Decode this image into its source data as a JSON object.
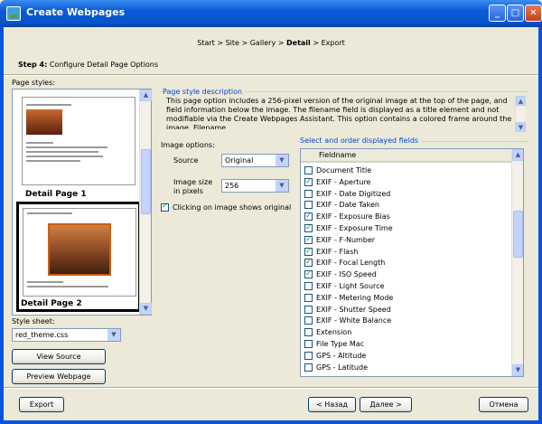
{
  "window": {
    "title": "Create Webpages"
  },
  "breadcrumb": {
    "pre": "Start > Site > Gallery > ",
    "current": "Detail",
    "post": " > Export"
  },
  "step": {
    "bold": "Step 4:",
    "text": " Configure Detail Page Options"
  },
  "page_styles": {
    "label": "Page styles:",
    "items": [
      {
        "caption": "Detail Page 1",
        "selected": false
      },
      {
        "caption": "Detail Page 2",
        "selected": true
      }
    ]
  },
  "style_sheet": {
    "label": "Style sheet:",
    "value": "red_theme.css"
  },
  "buttons": {
    "view_source": "View Source",
    "preview": "Preview Webpage",
    "export": "Export",
    "back": "< Назад",
    "next": "Далее >",
    "cancel": "Отмена"
  },
  "description": {
    "title": "Page style description",
    "text": "This page option includes a 256-pixel version of the original image at the top of the page, and field information below the image. The filename field is displayed as a title element and not modifiable via the Create Webpages Assistant. This option contains a colored frame around the image. Filename,"
  },
  "image_options": {
    "label": "Image options:",
    "source_label": "Source",
    "source_value": "Original",
    "size_label_1": "Image size",
    "size_label_2": "in pixels",
    "size_value": "256",
    "click_label": "Clicking on image shows original",
    "click_checked": true
  },
  "fields": {
    "title": "Select and order displayed fields",
    "header": "Fieldname",
    "items": [
      {
        "name": "Document Title",
        "checked": false
      },
      {
        "name": "EXIF - Aperture",
        "checked": true
      },
      {
        "name": "EXIF - Date Digitized",
        "checked": false
      },
      {
        "name": "EXIF - Date Taken",
        "checked": false
      },
      {
        "name": "EXIF - Exposure Bias",
        "checked": true
      },
      {
        "name": "EXIF - Exposure Time",
        "checked": true
      },
      {
        "name": "EXIF - F-Number",
        "checked": true
      },
      {
        "name": "EXIF - Flash",
        "checked": true
      },
      {
        "name": "EXIF - Focal Length",
        "checked": true
      },
      {
        "name": "EXIF - ISO Speed",
        "checked": true
      },
      {
        "name": "EXIF - Light Source",
        "checked": false
      },
      {
        "name": "EXIF - Metering Mode",
        "checked": false
      },
      {
        "name": "EXIF - Shutter Speed",
        "checked": false
      },
      {
        "name": "EXIF - White Balance",
        "checked": false
      },
      {
        "name": "Extension",
        "checked": false
      },
      {
        "name": "File Type Mac",
        "checked": false
      },
      {
        "name": "GPS - Altitude",
        "checked": false
      },
      {
        "name": "GPS - Latitude",
        "checked": false
      }
    ]
  }
}
